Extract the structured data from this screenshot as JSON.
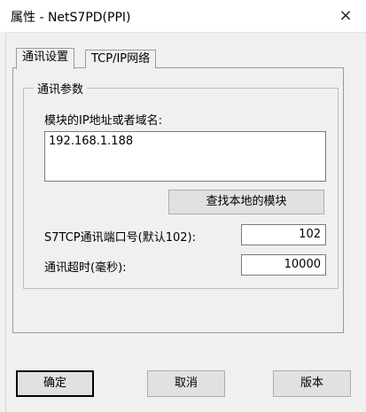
{
  "window": {
    "title": "属性 - NetS7PD(PPI)",
    "close_symbol": "×"
  },
  "tabs": [
    {
      "label": "通讯设置",
      "active": true
    },
    {
      "label": "TCP/IP网络",
      "active": false
    }
  ],
  "group": {
    "label": "通讯参数",
    "address_label": "模块的IP地址或者域名:",
    "address_value": "192.168.1.188",
    "find_button": "查找本地的模块",
    "port_label": "S7TCP通讯端口号(默认102):",
    "port_value": "102",
    "timeout_label": "通讯超时(毫秒):",
    "timeout_value": "10000"
  },
  "buttons": {
    "ok": "确定",
    "cancel": "取消",
    "version": "版本"
  }
}
